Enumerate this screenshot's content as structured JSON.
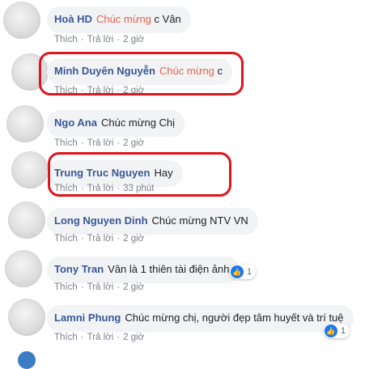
{
  "comments": [
    {
      "name": "Hoà HD",
      "pre": "",
      "highlight": "Chúc mừng",
      "post": "c Vân",
      "like": "Thích",
      "reply": "Trả lời",
      "time": "2 giờ",
      "reactions": ""
    },
    {
      "name": "Minh Duyên Nguyễn",
      "pre": "",
      "highlight": "Chúc mừng",
      "post": "c",
      "like": "Thích",
      "reply": "Trả lời",
      "time": "2 giờ",
      "reactions": ""
    },
    {
      "name": "Ngo Ana",
      "pre": "Chúc mừng Chị",
      "highlight": "",
      "post": "",
      "like": "Thích",
      "reply": "Trả lời",
      "time": "2 giờ",
      "reactions": ""
    },
    {
      "name": "Trung Truc Nguyen",
      "pre": "Hay",
      "highlight": "",
      "post": "",
      "like": "Thích",
      "reply": "Trả lời",
      "time": "33 phút",
      "reactions": ""
    },
    {
      "name": "Long Nguyen Dinh",
      "pre": "Chúc mừng NTV VN",
      "highlight": "",
      "post": "",
      "like": "Thích",
      "reply": "Trả lời",
      "time": "2 giờ",
      "reactions": ""
    },
    {
      "name": "Tony Tran",
      "pre": "Vân là 1 thiên tài điện ảnh",
      "highlight": "",
      "post": "",
      "like": "Thích",
      "reply": "Trả lời",
      "time": "2 giờ",
      "reactions": "1"
    },
    {
      "name": "Lamni Phung",
      "pre": "Chúc mừng chị, người đẹp tâm huyết và trí tuệ",
      "highlight": "",
      "post": "",
      "like": "Thích",
      "reply": "Trả lời",
      "time": "2 giờ",
      "reactions": "1"
    }
  ],
  "reaction_icon": "like-thumbs-up-icon",
  "colors": {
    "name": "#385898",
    "highlight": "#e9604a",
    "annotation": "#e0141c",
    "bubble": "#f2f3f5"
  }
}
